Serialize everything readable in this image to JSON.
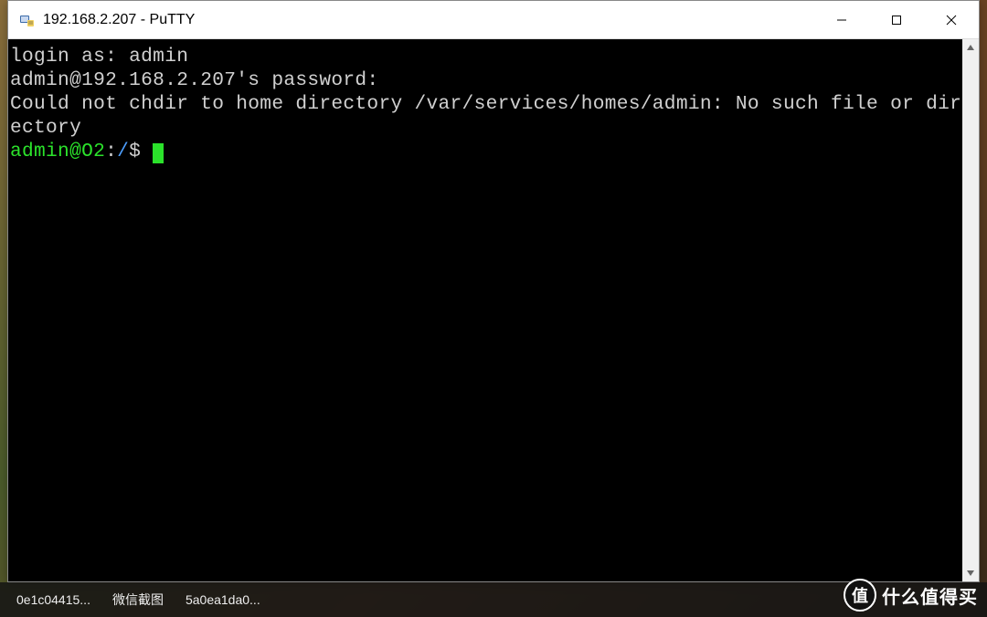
{
  "window": {
    "title": "192.168.2.207 - PuTTY",
    "app_icon": "putty-icon"
  },
  "terminal": {
    "lines": {
      "login_prompt": "login as: admin",
      "password_prompt": "admin@192.168.2.207's password:",
      "error_line": "Could not chdir to home directory /var/services/homes/admin: No such file or directory",
      "prompt_user": "admin@O2",
      "prompt_sep": ":",
      "prompt_path": "/",
      "prompt_end": "$ "
    }
  },
  "taskbar": {
    "items": [
      "0e1c04415...",
      "微信截图",
      "5a0ea1da0..."
    ]
  },
  "watermark": {
    "badge": "值",
    "text": "什么值得买"
  }
}
